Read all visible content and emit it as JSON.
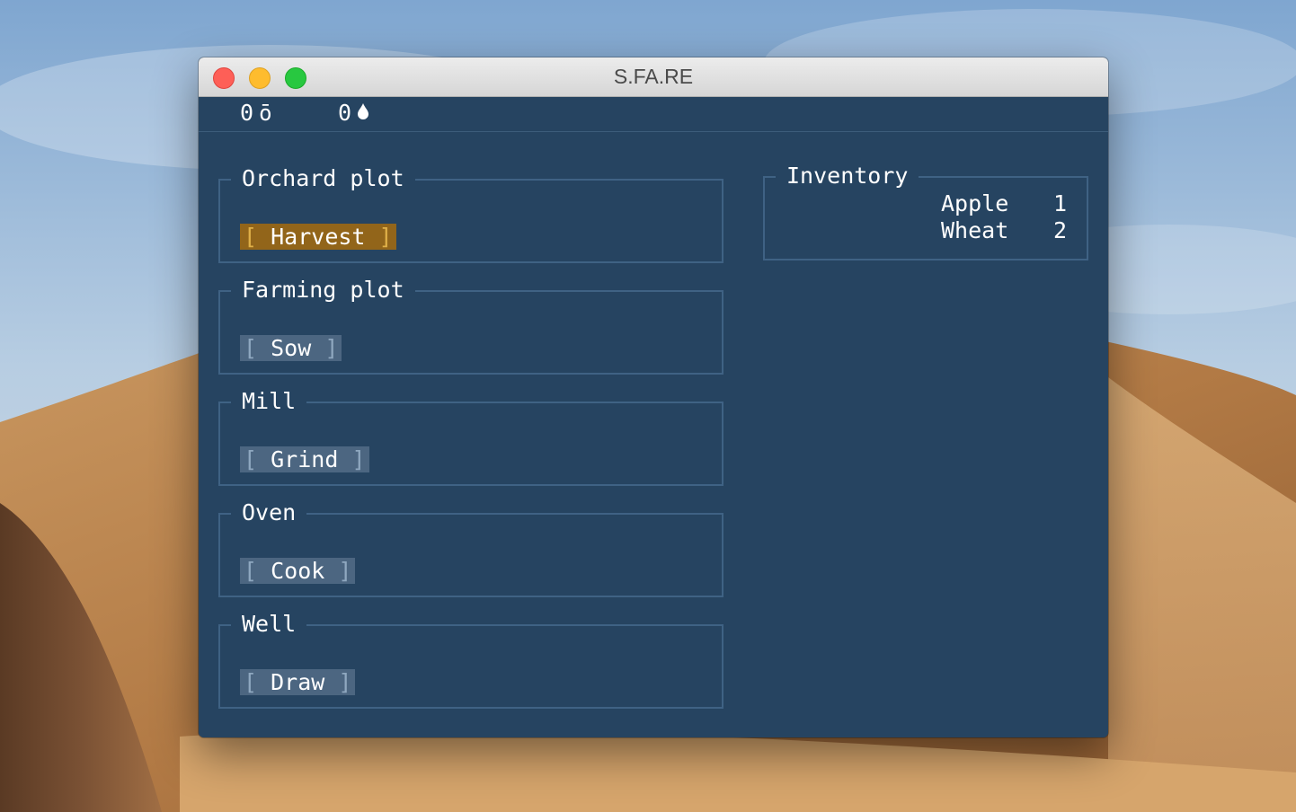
{
  "window": {
    "title": "S.FA.RE"
  },
  "status": {
    "coins_value": "0",
    "coins_icon": "ō",
    "water_value": "0",
    "water_icon": "water-drop-icon"
  },
  "panels": [
    {
      "title": "Orchard plot",
      "button": "Harvest",
      "active": true
    },
    {
      "title": "Farming plot",
      "button": "Sow",
      "active": false
    },
    {
      "title": "Mill",
      "button": "Grind",
      "active": false
    },
    {
      "title": "Oven",
      "button": "Cook",
      "active": false
    },
    {
      "title": "Well",
      "button": "Draw",
      "active": false
    }
  ],
  "inventory": {
    "title": "Inventory",
    "items": [
      {
        "name": "Apple",
        "qty": "1"
      },
      {
        "name": "Wheat",
        "qty": "2"
      }
    ]
  },
  "colors": {
    "background": "#264461",
    "border": "#3f6284",
    "button": "#4c6681",
    "button_active": "#92651a",
    "text": "#ffffff"
  }
}
